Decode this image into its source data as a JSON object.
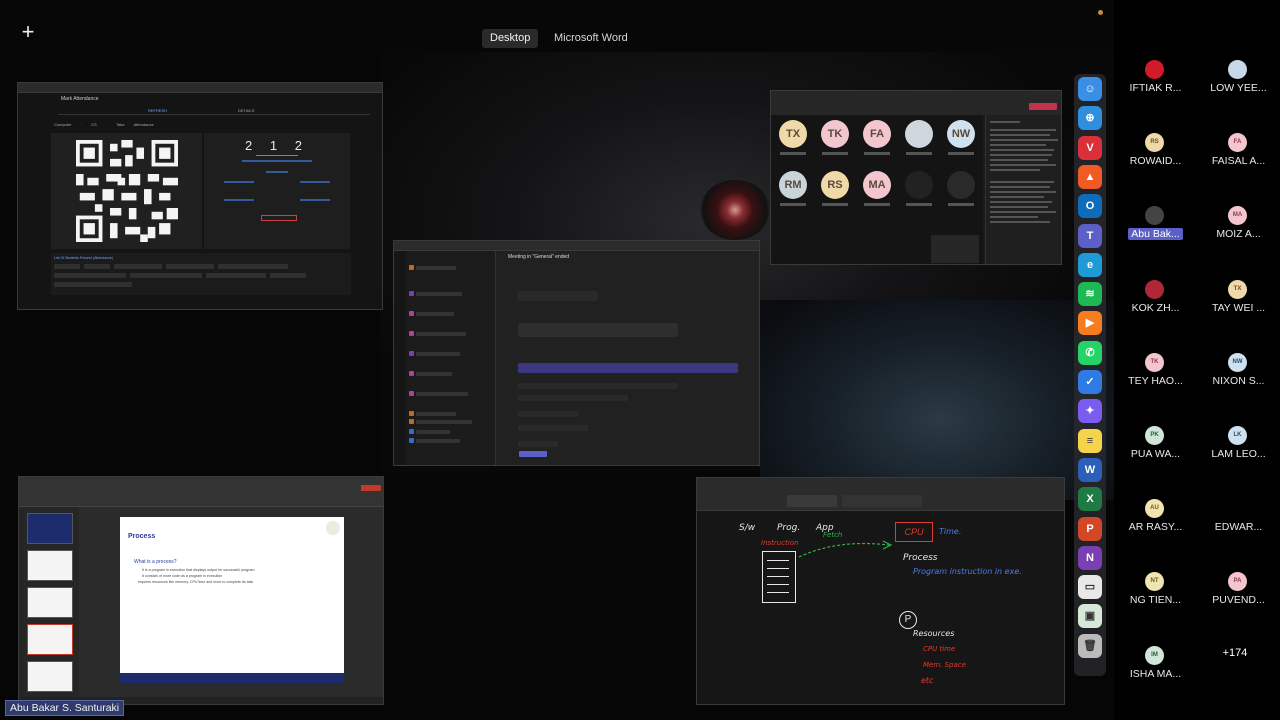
{
  "share_bar": {
    "tabs": [
      "Desktop",
      "Microsoft Word"
    ],
    "active_tab": "Desktop"
  },
  "attendance_window": {
    "title": "Mark Attendance",
    "tabs": [
      "REFRESH",
      "DETAILS"
    ],
    "breadcrumb": "Computer   ·   CS   ·   Take Attendance",
    "code": "2 1 2",
    "list_title": "List Of Students Present (Attendance)"
  },
  "teams_window": {
    "channel_header": "Meeting in \"General\" ended"
  },
  "meeting_window": {
    "avatars": [
      {
        "initials": "TX",
        "color": "#f0d9a8"
      },
      {
        "initials": "TK",
        "color": "#f3c6cf"
      },
      {
        "initials": "FA",
        "color": "#f3c6cf"
      },
      {
        "initials": "",
        "color": "#cfd6de"
      },
      {
        "initials": "NW",
        "color": "#cfe0ef"
      },
      {
        "initials": "RM",
        "color": "#c9d4d8"
      },
      {
        "initials": "RS",
        "color": "#f0d9a8"
      },
      {
        "initials": "MA",
        "color": "#f3c6cf"
      },
      {
        "initials": "",
        "color": "#222222"
      },
      {
        "initials": "",
        "color": "#2a2a2a"
      }
    ]
  },
  "ppt_window": {
    "slide_title": "Process",
    "slide_subtitle": "What is a process?",
    "slide_lines": [
      "It is a program in execution that displays output for successful program",
      "It consists of more code as a program in execution",
      "requires resources like memory, CPU time and more to complete its task"
    ]
  },
  "whiteboard": {
    "labels": {
      "sw": "S/w",
      "prog": "Prog.",
      "app": "App",
      "instruction": "Instruction",
      "fetch": "Fetch",
      "cpu": "CPU",
      "time": "Time.",
      "process": "Process",
      "program_instruction": "Program instruction in exe.",
      "p": "P",
      "resources": "Resources",
      "cpu_time": "CPU time",
      "mem_space": "Mem. Space",
      "etc": "etc"
    }
  },
  "participants": [
    {
      "name": "IFTIAK R...",
      "initials": "",
      "bg": "#d11a2a",
      "fg": "#fff"
    },
    {
      "name": "LOW YEE...",
      "initials": "",
      "bg": "#c8d8e8",
      "fg": "#333"
    },
    {
      "name": "ROWAID...",
      "initials": "RS",
      "bg": "#f0d9a8",
      "fg": "#6b4a2a"
    },
    {
      "name": "FAISAL A...",
      "initials": "FA",
      "bg": "#f3c6cf",
      "fg": "#8a3a4a"
    },
    {
      "name": "Abu Bak...",
      "initials": "",
      "bg": "#444444",
      "fg": "#fff",
      "highlight": true
    },
    {
      "name": "MOIZ A...",
      "initials": "MA",
      "bg": "#f3c6cf",
      "fg": "#8a3a4a"
    },
    {
      "name": "KOK ZH...",
      "initials": "",
      "bg": "#b02838",
      "fg": "#fff"
    },
    {
      "name": "TAY WEI ...",
      "initials": "TX",
      "bg": "#f0d9a8",
      "fg": "#6b4a2a"
    },
    {
      "name": "TEY HAO...",
      "initials": "TK",
      "bg": "#f3c6cf",
      "fg": "#8a3a4a"
    },
    {
      "name": "NIXON S...",
      "initials": "NW",
      "bg": "#cfe0ef",
      "fg": "#2a4a6a"
    },
    {
      "name": "PUA WA...",
      "initials": "PK",
      "bg": "#cfe6d8",
      "fg": "#2a5a3a"
    },
    {
      "name": "LAM LEO...",
      "initials": "LK",
      "bg": "#cfe0ef",
      "fg": "#2a4a6a"
    },
    {
      "name": "AR RASY...",
      "initials": "AU",
      "bg": "#f0e4b0",
      "fg": "#6b5a2a"
    },
    {
      "name": "EDWAR...",
      "initials": "",
      "bg": "#000000",
      "fg": "#fff"
    },
    {
      "name": "NG TIEN...",
      "initials": "NT",
      "bg": "#f0e4b0",
      "fg": "#6b5a2a"
    },
    {
      "name": "PUVEND...",
      "initials": "PA",
      "bg": "#f3c6cf",
      "fg": "#8a3a4a"
    },
    {
      "name": "ISHA MA...",
      "initials": "IM",
      "bg": "#cfe6d8",
      "fg": "#2a5a3a"
    }
  ],
  "more_participants": "+174",
  "presenter_label": "Abu Bakar S. Santuraki",
  "dock_icons": [
    {
      "name": "finder-icon",
      "color": "#3a8ee6",
      "glyph": "☺"
    },
    {
      "name": "safari-icon",
      "color": "#2f8fdc",
      "glyph": "⊕"
    },
    {
      "name": "vivaldi-icon",
      "color": "#d9303a",
      "glyph": "V"
    },
    {
      "name": "brave-icon",
      "color": "#f05a24",
      "glyph": "▲"
    },
    {
      "name": "outlook-icon",
      "color": "#0f6cbd",
      "glyph": "O"
    },
    {
      "name": "teams-icon",
      "color": "#5b5fc7",
      "glyph": "T"
    },
    {
      "name": "edge-icon",
      "color": "#1e9ad6",
      "glyph": "e"
    },
    {
      "name": "spotify-icon",
      "color": "#1db954",
      "glyph": "≋"
    },
    {
      "name": "media-player-icon",
      "color": "#f57c1f",
      "glyph": "▶"
    },
    {
      "name": "whatsapp-icon",
      "color": "#25d366",
      "glyph": "✆"
    },
    {
      "name": "todo-icon",
      "color": "#2f7be6",
      "glyph": "✓"
    },
    {
      "name": "copilot-icon",
      "color": "#7a5cf0",
      "glyph": "✦"
    },
    {
      "name": "notes-icon",
      "color": "#f5d34a",
      "glyph": "≡"
    },
    {
      "name": "word-icon",
      "color": "#2b5fb8",
      "glyph": "W"
    },
    {
      "name": "excel-icon",
      "color": "#1f7a44",
      "glyph": "X"
    },
    {
      "name": "powerpoint-icon",
      "color": "#d24726",
      "glyph": "P"
    },
    {
      "name": "onenote-icon",
      "color": "#7b3fb5",
      "glyph": "N"
    },
    {
      "name": "preview-icon",
      "color": "#e8e8e8",
      "glyph": "▭"
    },
    {
      "name": "image-capture-icon",
      "color": "#d8e8d8",
      "glyph": "▣"
    },
    {
      "name": "trash-icon",
      "color": "#bbbbbb",
      "glyph": "🗑"
    }
  ]
}
